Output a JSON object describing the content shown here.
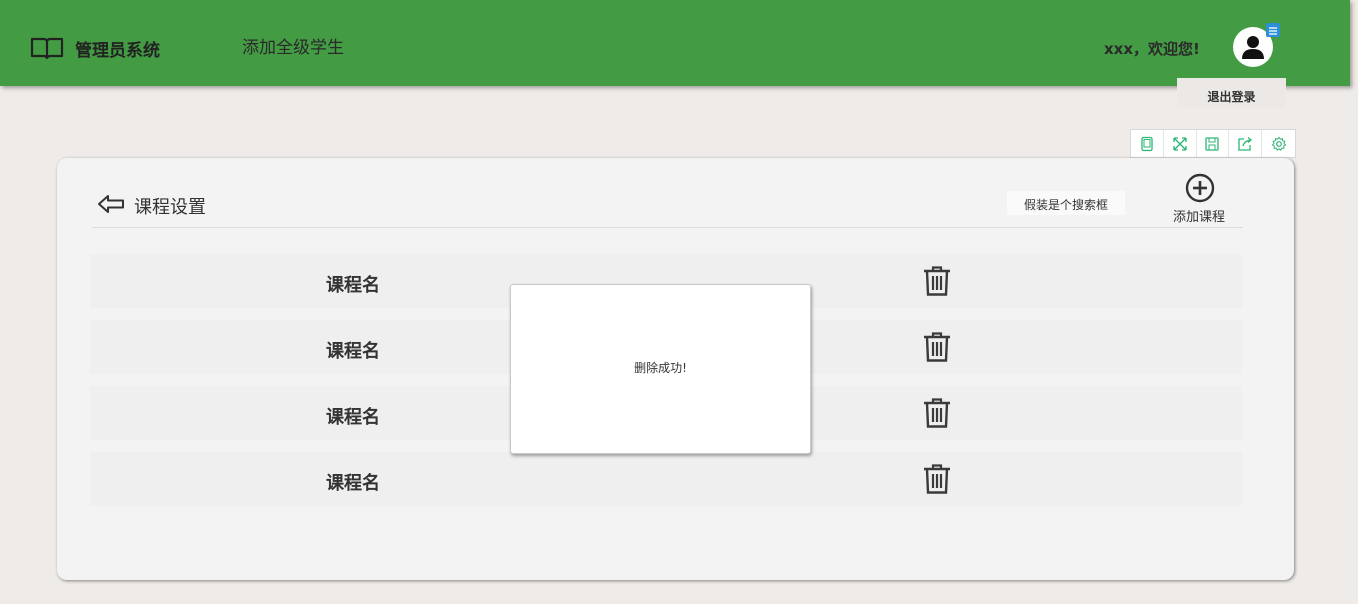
{
  "header": {
    "brand": "管理员系统",
    "nav_link": "添加全级学生",
    "welcome": "xxx，欢迎您!",
    "logout": "退出登录"
  },
  "toolbar": {
    "items": [
      "tablet-icon",
      "fullscreen-icon",
      "save-icon",
      "share-icon",
      "settings-icon"
    ]
  },
  "page": {
    "title": "课程设置",
    "search_placeholder": "假装是个搜索框",
    "add_label": "添加课程"
  },
  "courses": [
    {
      "name": "课程名"
    },
    {
      "name": "课程名"
    },
    {
      "name": "课程名"
    },
    {
      "name": "课程名"
    }
  ],
  "dialog": {
    "message": "删除成功!"
  },
  "colors": {
    "header_bg": "#439c43",
    "toolbar_icon": "#2bb673",
    "badge": "#2d8fd8"
  }
}
